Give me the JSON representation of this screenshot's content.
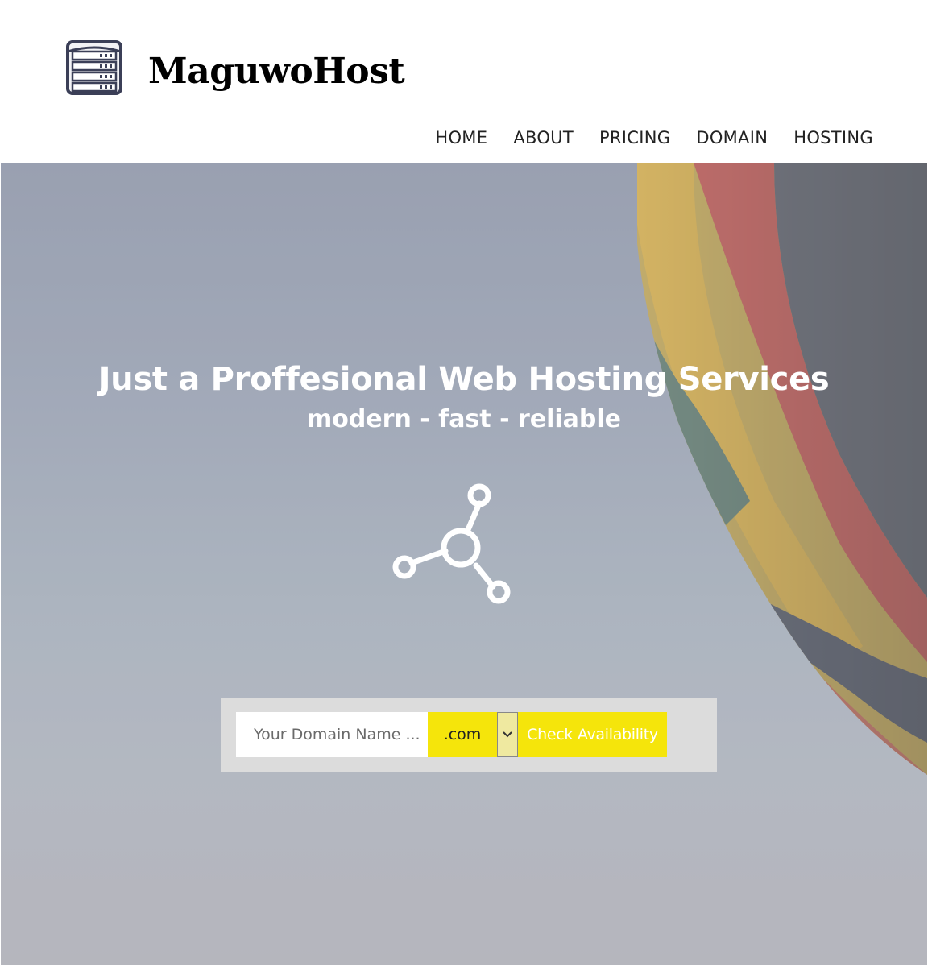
{
  "brand": {
    "name": "MaguwoHost",
    "logo_icon": "server-rack-icon"
  },
  "nav": {
    "items": [
      "HOME",
      "ABOUT",
      "PRICING",
      "DOMAIN",
      "HOSTING"
    ]
  },
  "hero": {
    "title": "Just a Proffesional Web Hosting Services",
    "subtitle": "modern - fast - reliable",
    "icon": "share-network-icon"
  },
  "domain_search": {
    "placeholder": "Your Domain Name ...",
    "tld_selected": ".com",
    "button_label": "Check Availability"
  },
  "colors": {
    "accent": "#f5e50b",
    "text_dark": "#222222",
    "hero_text": "#ffffff"
  }
}
